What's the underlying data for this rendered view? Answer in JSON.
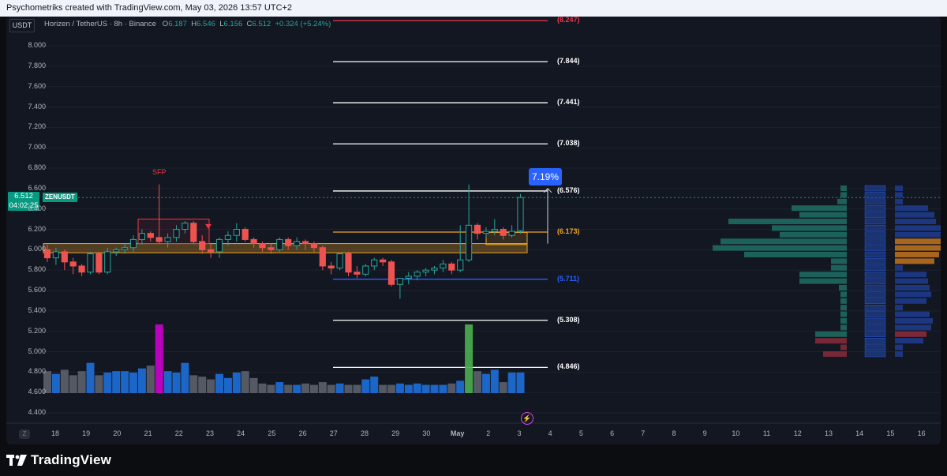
{
  "header": {
    "title": "Psychometriks created with TradingView.com, May 03, 2026 13:57 UTC+2"
  },
  "legend": {
    "symbol": "USDT",
    "pair": "Horizen / TetherUS · 8h · Binance",
    "o_label": "O",
    "o": "6.187",
    "h_label": "H",
    "h": "6.546",
    "l_label": "L",
    "l": "6.156",
    "c_label": "C",
    "c": "6.512",
    "change": "+0.324 (+5.24%)"
  },
  "price_tag": {
    "price": "6.512",
    "countdown": "04:02:25",
    "symbol": "ZENUSDT"
  },
  "annotations": {
    "sfp": "SFP",
    "pct_badge": "7.19%",
    "zbutton": "Z",
    "bolt": "⚡"
  },
  "levels": [
    {
      "label": "(8.247)",
      "value": 8.247,
      "color": "#f23645"
    },
    {
      "label": "(7.844)",
      "value": 7.844,
      "color": "#ffffff"
    },
    {
      "label": "(7.441)",
      "value": 7.441,
      "color": "#ffffff"
    },
    {
      "label": "(7.038)",
      "value": 7.038,
      "color": "#ffffff"
    },
    {
      "label": "(6.576)",
      "value": 6.576,
      "color": "#ffffff"
    },
    {
      "label": "(6.173)",
      "value": 6.173,
      "color": "#f5a623"
    },
    {
      "label": "(5.711)",
      "value": 5.711,
      "color": "#2962ff"
    },
    {
      "label": "(5.308)",
      "value": 5.308,
      "color": "#ffffff"
    },
    {
      "label": "(4.846)",
      "value": 4.846,
      "color": "#ffffff"
    }
  ],
  "y_axis": [
    "8.000",
    "7.800",
    "7.600",
    "7.400",
    "7.200",
    "7.000",
    "6.800",
    "6.600",
    "6.400",
    "6.200",
    "6.000",
    "5.800",
    "5.600",
    "5.400",
    "5.200",
    "5.000",
    "4.800",
    "4.600",
    "4.400"
  ],
  "x_axis": [
    "18",
    "19",
    "20",
    "21",
    "22",
    "23",
    "24",
    "25",
    "26",
    "27",
    "28",
    "29",
    "30",
    "May",
    "2",
    "3",
    "4",
    "5",
    "6",
    "7",
    "8",
    "9",
    "10",
    "11",
    "12",
    "13",
    "14",
    "15",
    "16"
  ],
  "chart_data": {
    "type": "candlestick",
    "symbol": "ZENUSDT",
    "timeframe": "8h",
    "ylim": [
      4.4,
      8.05
    ],
    "candles": [
      [
        6.0,
        6.05,
        5.88,
        5.92
      ],
      [
        5.92,
        6.02,
        5.85,
        5.98
      ],
      [
        5.98,
        6.0,
        5.8,
        5.88
      ],
      [
        5.88,
        5.92,
        5.76,
        5.84
      ],
      [
        5.84,
        5.86,
        5.74,
        5.78
      ],
      [
        5.78,
        5.98,
        5.76,
        5.96
      ],
      [
        5.96,
        5.98,
        5.76,
        5.78
      ],
      [
        5.78,
        6.02,
        5.76,
        5.98
      ],
      [
        5.98,
        6.02,
        5.94,
        6.0
      ],
      [
        6.0,
        6.06,
        5.96,
        6.02
      ],
      [
        6.02,
        6.14,
        5.98,
        6.1
      ],
      [
        6.1,
        6.2,
        6.05,
        6.16
      ],
      [
        6.16,
        6.18,
        6.08,
        6.12
      ],
      [
        6.12,
        6.64,
        6.06,
        6.08
      ],
      [
        6.08,
        6.16,
        6.02,
        6.12
      ],
      [
        6.12,
        6.24,
        6.08,
        6.2
      ],
      [
        6.2,
        6.28,
        6.16,
        6.26
      ],
      [
        6.26,
        6.28,
        6.06,
        6.08
      ],
      [
        6.08,
        6.14,
        5.96,
        6.0
      ],
      [
        6.0,
        6.06,
        5.92,
        5.98
      ],
      [
        5.98,
        6.12,
        5.92,
        6.1
      ],
      [
        6.1,
        6.18,
        6.04,
        6.14
      ],
      [
        6.14,
        6.26,
        6.08,
        6.2
      ],
      [
        6.2,
        6.22,
        6.08,
        6.1
      ],
      [
        6.1,
        6.12,
        6.02,
        6.06
      ],
      [
        6.06,
        6.08,
        5.98,
        6.02
      ],
      [
        6.02,
        6.06,
        5.96,
        6.0
      ],
      [
        6.0,
        6.12,
        5.98,
        6.1
      ],
      [
        6.1,
        6.12,
        6.0,
        6.04
      ],
      [
        6.04,
        6.12,
        6.0,
        6.08
      ],
      [
        6.08,
        6.1,
        6.0,
        6.06
      ],
      [
        6.06,
        6.08,
        5.98,
        6.02
      ],
      [
        6.02,
        6.04,
        5.8,
        5.84
      ],
      [
        5.84,
        5.88,
        5.76,
        5.82
      ],
      [
        5.82,
        5.96,
        5.8,
        5.96
      ],
      [
        5.96,
        5.98,
        5.74,
        5.78
      ],
      [
        5.78,
        5.84,
        5.72,
        5.76
      ],
      [
        5.76,
        5.86,
        5.74,
        5.84
      ],
      [
        5.84,
        5.92,
        5.8,
        5.9
      ],
      [
        5.9,
        5.92,
        5.84,
        5.88
      ],
      [
        5.88,
        5.9,
        5.64,
        5.66
      ],
      [
        5.66,
        5.72,
        5.52,
        5.72
      ],
      [
        5.72,
        5.78,
        5.66,
        5.74
      ],
      [
        5.74,
        5.8,
        5.7,
        5.78
      ],
      [
        5.78,
        5.82,
        5.74,
        5.8
      ],
      [
        5.8,
        5.84,
        5.76,
        5.82
      ],
      [
        5.82,
        5.9,
        5.78,
        5.86
      ],
      [
        5.86,
        5.88,
        5.76,
        5.8
      ],
      [
        5.8,
        6.24,
        5.78,
        5.9
      ],
      [
        5.9,
        6.64,
        5.88,
        6.24
      ],
      [
        6.24,
        6.26,
        6.1,
        6.16
      ],
      [
        6.16,
        6.22,
        6.12,
        6.18
      ],
      [
        6.18,
        6.3,
        6.14,
        6.2
      ],
      [
        6.2,
        6.22,
        6.1,
        6.14
      ],
      [
        6.14,
        6.24,
        6.12,
        6.18
      ],
      [
        6.187,
        6.546,
        6.156,
        6.512
      ]
    ],
    "volume": [
      0.32,
      0.28,
      0.34,
      0.26,
      0.32,
      0.44,
      0.26,
      0.3,
      0.32,
      0.32,
      0.3,
      0.36,
      0.4,
      1.0,
      0.32,
      0.3,
      0.44,
      0.26,
      0.24,
      0.2,
      0.28,
      0.22,
      0.3,
      0.32,
      0.22,
      0.14,
      0.12,
      0.16,
      0.12,
      0.12,
      0.14,
      0.12,
      0.16,
      0.12,
      0.14,
      0.12,
      0.12,
      0.2,
      0.24,
      0.12,
      0.12,
      0.14,
      0.12,
      0.14,
      0.12,
      0.12,
      0.12,
      0.14,
      0.18,
      1.0,
      0.32,
      0.28,
      0.34,
      0.16,
      0.3,
      0.3
    ],
    "volume_colors": {
      "neutral": "#5d606b",
      "up": "#1e6fd9",
      "spike": "#cc00cc",
      "spike2": "#4caf50"
    }
  }
}
